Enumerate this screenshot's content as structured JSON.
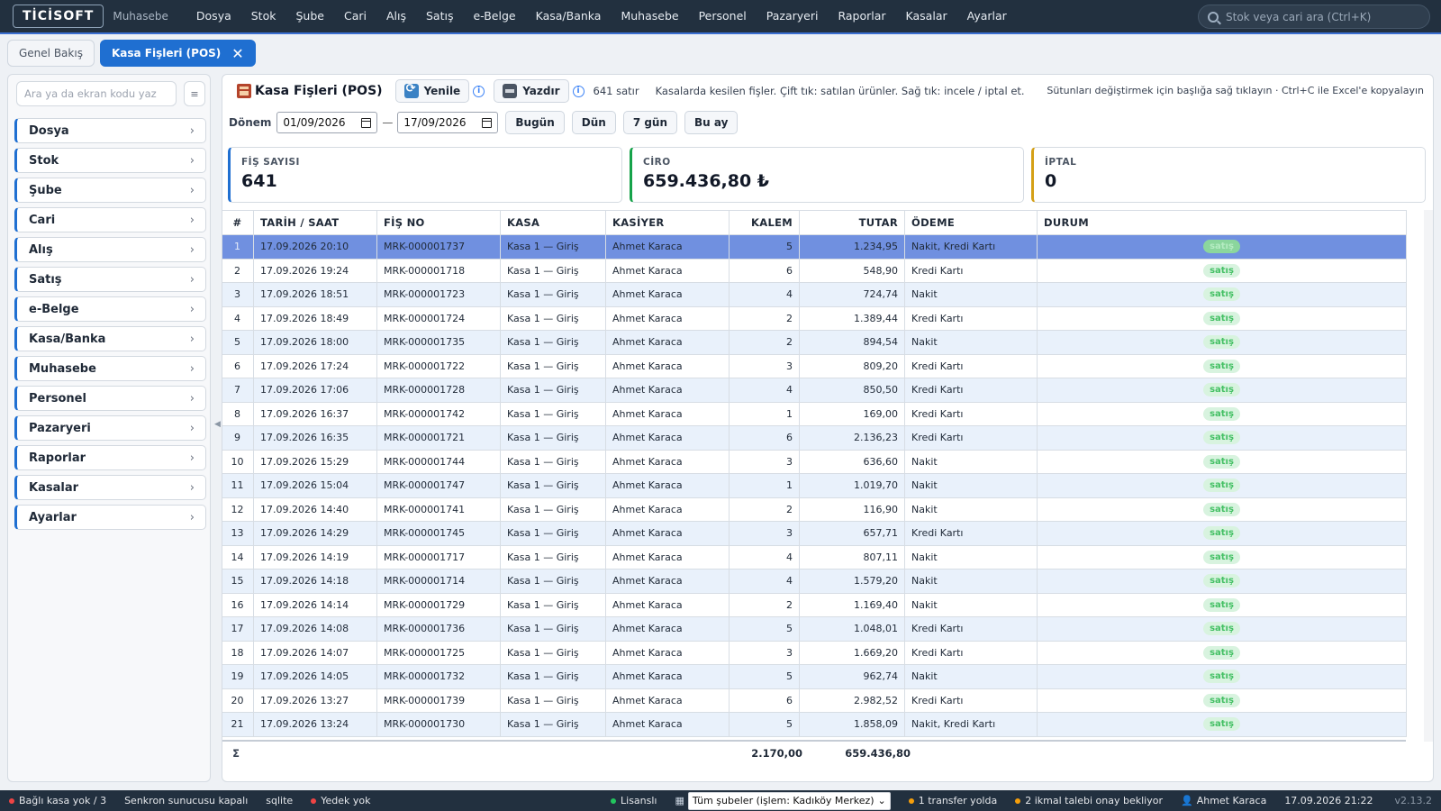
{
  "app": {
    "logo": "TİCİSOFT",
    "subtitle": "Muhasebe"
  },
  "menu": [
    "Dosya",
    "Stok",
    "Şube",
    "Cari",
    "Alış",
    "Satış",
    "e-Belge",
    "Kasa/Banka",
    "Muhasebe",
    "Personel",
    "Pazaryeri",
    "Raporlar",
    "Kasalar",
    "Ayarlar"
  ],
  "search": {
    "placeholder": "Stok veya cari ara (Ctrl+K)"
  },
  "tabs": [
    {
      "label": "Genel Bakış",
      "active": false
    },
    {
      "label": "Kasa Fişleri (POS)",
      "active": true,
      "close": "✕"
    }
  ],
  "sidebar": {
    "search_placeholder": "Ara ya da ekran kodu yaz",
    "toggle_label": "≡",
    "items": [
      "Dosya",
      "Stok",
      "Şube",
      "Cari",
      "Alış",
      "Satış",
      "e-Belge",
      "Kasa/Banka",
      "Muhasebe",
      "Personel",
      "Pazaryeri",
      "Raporlar",
      "Kasalar",
      "Ayarlar"
    ]
  },
  "page": {
    "title": "Kasa Fişleri (POS)",
    "refresh_label": "Yenile",
    "print_label": "Yazdır",
    "row_count": "641 satır",
    "description": "Kasalarda kesilen fişler. Çift tık: satılan ürünler. Sağ tık: incele / iptal et.",
    "hint": "Sütunları değiştirmek için başlığa sağ tıklayın · Ctrl+C ile Excel'e kopyalayın"
  },
  "filter": {
    "label": "Dönem",
    "from": "01/09/2026",
    "to": "17/09/2026",
    "separator": "—",
    "buttons": [
      "Bugün",
      "Dün",
      "7 gün",
      "Bu ay"
    ]
  },
  "cards": [
    {
      "label": "FİŞ SAYISI",
      "value": "641",
      "accent": "#1f6fd1"
    },
    {
      "label": "CİRO",
      "value": "659.436,80 ₺",
      "accent": "#16a34a"
    },
    {
      "label": "İPTAL",
      "value": "0",
      "accent": "#d4a017"
    }
  ],
  "table": {
    "columns": [
      "#",
      "TARİH / SAAT",
      "FİŞ NO",
      "KASA",
      "KASİYER",
      "KALEM",
      "TUTAR",
      "ÖDEME",
      "DURUM"
    ],
    "rows": [
      [
        "1",
        "17.09.2026 20:10",
        "MRK-000001737",
        "Kasa 1 — Giriş",
        "Ahmet Karaca",
        "5",
        "1.234,95",
        "Nakit, Kredi Kartı",
        "satış"
      ],
      [
        "2",
        "17.09.2026 19:24",
        "MRK-000001718",
        "Kasa 1 — Giriş",
        "Ahmet Karaca",
        "6",
        "548,90",
        "Kredi Kartı",
        "satış"
      ],
      [
        "3",
        "17.09.2026 18:51",
        "MRK-000001723",
        "Kasa 1 — Giriş",
        "Ahmet Karaca",
        "4",
        "724,74",
        "Nakit",
        "satış"
      ],
      [
        "4",
        "17.09.2026 18:49",
        "MRK-000001724",
        "Kasa 1 — Giriş",
        "Ahmet Karaca",
        "2",
        "1.389,44",
        "Kredi Kartı",
        "satış"
      ],
      [
        "5",
        "17.09.2026 18:00",
        "MRK-000001735",
        "Kasa 1 — Giriş",
        "Ahmet Karaca",
        "2",
        "894,54",
        "Nakit",
        "satış"
      ],
      [
        "6",
        "17.09.2026 17:24",
        "MRK-000001722",
        "Kasa 1 — Giriş",
        "Ahmet Karaca",
        "3",
        "809,20",
        "Kredi Kartı",
        "satış"
      ],
      [
        "7",
        "17.09.2026 17:06",
        "MRK-000001728",
        "Kasa 1 — Giriş",
        "Ahmet Karaca",
        "4",
        "850,50",
        "Kredi Kartı",
        "satış"
      ],
      [
        "8",
        "17.09.2026 16:37",
        "MRK-000001742",
        "Kasa 1 — Giriş",
        "Ahmet Karaca",
        "1",
        "169,00",
        "Kredi Kartı",
        "satış"
      ],
      [
        "9",
        "17.09.2026 16:35",
        "MRK-000001721",
        "Kasa 1 — Giriş",
        "Ahmet Karaca",
        "6",
        "2.136,23",
        "Kredi Kartı",
        "satış"
      ],
      [
        "10",
        "17.09.2026 15:29",
        "MRK-000001744",
        "Kasa 1 — Giriş",
        "Ahmet Karaca",
        "3",
        "636,60",
        "Nakit",
        "satış"
      ],
      [
        "11",
        "17.09.2026 15:04",
        "MRK-000001747",
        "Kasa 1 — Giriş",
        "Ahmet Karaca",
        "1",
        "1.019,70",
        "Nakit",
        "satış"
      ],
      [
        "12",
        "17.09.2026 14:40",
        "MRK-000001741",
        "Kasa 1 — Giriş",
        "Ahmet Karaca",
        "2",
        "116,90",
        "Nakit",
        "satış"
      ],
      [
        "13",
        "17.09.2026 14:29",
        "MRK-000001745",
        "Kasa 1 — Giriş",
        "Ahmet Karaca",
        "3",
        "657,71",
        "Kredi Kartı",
        "satış"
      ],
      [
        "14",
        "17.09.2026 14:19",
        "MRK-000001717",
        "Kasa 1 — Giriş",
        "Ahmet Karaca",
        "4",
        "807,11",
        "Nakit",
        "satış"
      ],
      [
        "15",
        "17.09.2026 14:18",
        "MRK-000001714",
        "Kasa 1 — Giriş",
        "Ahmet Karaca",
        "4",
        "1.579,20",
        "Nakit",
        "satış"
      ],
      [
        "16",
        "17.09.2026 14:14",
        "MRK-000001729",
        "Kasa 1 — Giriş",
        "Ahmet Karaca",
        "2",
        "1.169,40",
        "Nakit",
        "satış"
      ],
      [
        "17",
        "17.09.2026 14:08",
        "MRK-000001736",
        "Kasa 1 — Giriş",
        "Ahmet Karaca",
        "5",
        "1.048,01",
        "Kredi Kartı",
        "satış"
      ],
      [
        "18",
        "17.09.2026 14:07",
        "MRK-000001725",
        "Kasa 1 — Giriş",
        "Ahmet Karaca",
        "3",
        "1.669,20",
        "Kredi Kartı",
        "satış"
      ],
      [
        "19",
        "17.09.2026 14:05",
        "MRK-000001732",
        "Kasa 1 — Giriş",
        "Ahmet Karaca",
        "5",
        "962,74",
        "Nakit",
        "satış"
      ],
      [
        "20",
        "17.09.2026 13:27",
        "MRK-000001739",
        "Kasa 1 — Giriş",
        "Ahmet Karaca",
        "6",
        "2.982,52",
        "Kredi Kartı",
        "satış"
      ],
      [
        "21",
        "17.09.2026 13:24",
        "MRK-000001730",
        "Kasa 1 — Giriş",
        "Ahmet Karaca",
        "5",
        "1.858,09",
        "Nakit, Kredi Kartı",
        "satış"
      ]
    ],
    "selected_row": 0,
    "totals": {
      "symbol": "Σ",
      "kalem": "2.170,00",
      "tutar": "659.436,80"
    }
  },
  "statusbar": {
    "left": [
      {
        "text": "Bağlı kasa yok / 3",
        "dot": "#ef4444"
      },
      {
        "text": "Senkron sunucusu kapalı",
        "dot": ""
      },
      {
        "text": "sqlite",
        "dot": ""
      },
      {
        "text": "Yedek yok",
        "dot": "#ef4444"
      }
    ],
    "license": "Lisanslı",
    "branch_select": "Tüm şubeler (işlem: Kadıköy Merkez)",
    "transfer": "1 transfer yolda",
    "supply": "2 ikmal talebi onay bekliyor",
    "user": "Ahmet Karaca",
    "datetime": "17.09.2026 21:22",
    "version": "v2.13.2"
  }
}
